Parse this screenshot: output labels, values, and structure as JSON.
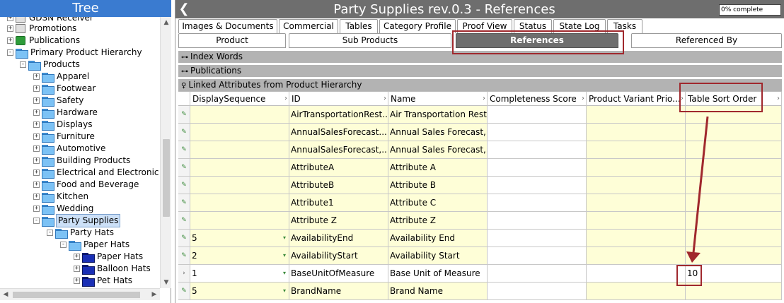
{
  "tree": {
    "title": "Tree",
    "nodes": [
      {
        "label": "GDSN Receiver",
        "icon": "gear"
      },
      {
        "label": "Promotions",
        "icon": "gear"
      },
      {
        "label": "Publications",
        "icon": "publication"
      },
      {
        "label": "Primary Product Hierarchy",
        "icon": "folder"
      },
      {
        "label": "Products",
        "icon": "folder"
      },
      {
        "label": "Apparel",
        "icon": "folder"
      },
      {
        "label": "Footwear",
        "icon": "folder"
      },
      {
        "label": "Safety",
        "icon": "folder"
      },
      {
        "label": "Hardware",
        "icon": "folder"
      },
      {
        "label": "Displays",
        "icon": "folder"
      },
      {
        "label": "Furniture",
        "icon": "folder"
      },
      {
        "label": "Automotive",
        "icon": "folder"
      },
      {
        "label": "Building Products",
        "icon": "folder"
      },
      {
        "label": "Electrical and Electronic",
        "icon": "folder"
      },
      {
        "label": "Food and Beverage",
        "icon": "folder"
      },
      {
        "label": "Kitchen",
        "icon": "folder"
      },
      {
        "label": "Wedding",
        "icon": "folder"
      },
      {
        "label": "Party Supplies",
        "icon": "folder",
        "selected": true
      },
      {
        "label": "Party Hats",
        "icon": "folder"
      },
      {
        "label": "Paper Hats",
        "icon": "folder"
      },
      {
        "label": "Paper Hats",
        "icon": "folder-dark"
      },
      {
        "label": "Balloon Hats",
        "icon": "folder-dark"
      },
      {
        "label": "Pet Hats",
        "icon": "folder-dark"
      }
    ]
  },
  "header": {
    "back_glyph": "❮",
    "title": "Party Supplies rev.0.3 - References",
    "progress": "0% complete"
  },
  "tabs_top": [
    "Images & Documents",
    "Commercial",
    "Tables",
    "Category Profile",
    "Proof View",
    "Status",
    "State Log",
    "Tasks"
  ],
  "tabs_sub": [
    {
      "label": "Product",
      "active": false
    },
    {
      "label": "Sub Products",
      "active": false
    },
    {
      "label": "References",
      "active": true
    },
    {
      "label": "Referenced By",
      "active": false
    }
  ],
  "sections": {
    "index_words": "Index Words",
    "publications": "Publications",
    "linked_attributes": "Linked Attributes from Product Hierarchy"
  },
  "grid": {
    "columns": [
      "DisplaySequence",
      "ID",
      "Name",
      "Completeness Score",
      "Product Variant Prio...",
      "Table Sort Order"
    ],
    "rows": [
      {
        "seq": "",
        "id": "AirTransportationRest...",
        "name": "Air Transportation Restri",
        "sort": ""
      },
      {
        "seq": "",
        "id": "AnnualSalesForecast...",
        "name": "Annual Sales Forecast, M",
        "sort": ""
      },
      {
        "seq": "",
        "id": "AnnualSalesForecast,...",
        "name": "Annual Sales Forecast, N",
        "sort": ""
      },
      {
        "seq": "",
        "id": "AttributeA",
        "name": "Attribute A",
        "sort": ""
      },
      {
        "seq": "",
        "id": "AttributeB",
        "name": "Attribute B",
        "sort": ""
      },
      {
        "seq": "",
        "id": "Attribute1",
        "name": "Attribute C",
        "sort": ""
      },
      {
        "seq": "",
        "id": "Attribute Z",
        "name": "Attribute Z",
        "sort": ""
      },
      {
        "seq": "5",
        "id": "AvailabilityEnd",
        "name": "Availability End",
        "sort": ""
      },
      {
        "seq": "2",
        "id": "AvailabilityStart",
        "name": "Availability Start",
        "sort": ""
      },
      {
        "seq": "1",
        "id": "BaseUnitOfMeasure",
        "name": "Base Unit of Measure",
        "sort": "10",
        "current": true
      },
      {
        "seq": "5",
        "id": "BrandName",
        "name": "Brand Name",
        "sort": ""
      }
    ]
  },
  "colors": {
    "tree_header": "#3a7bd0",
    "title_bar": "#6e6e6e",
    "active_tab": "#6e6e6e",
    "annotation": "#a0282d",
    "editable_cell": "#fefed7"
  }
}
